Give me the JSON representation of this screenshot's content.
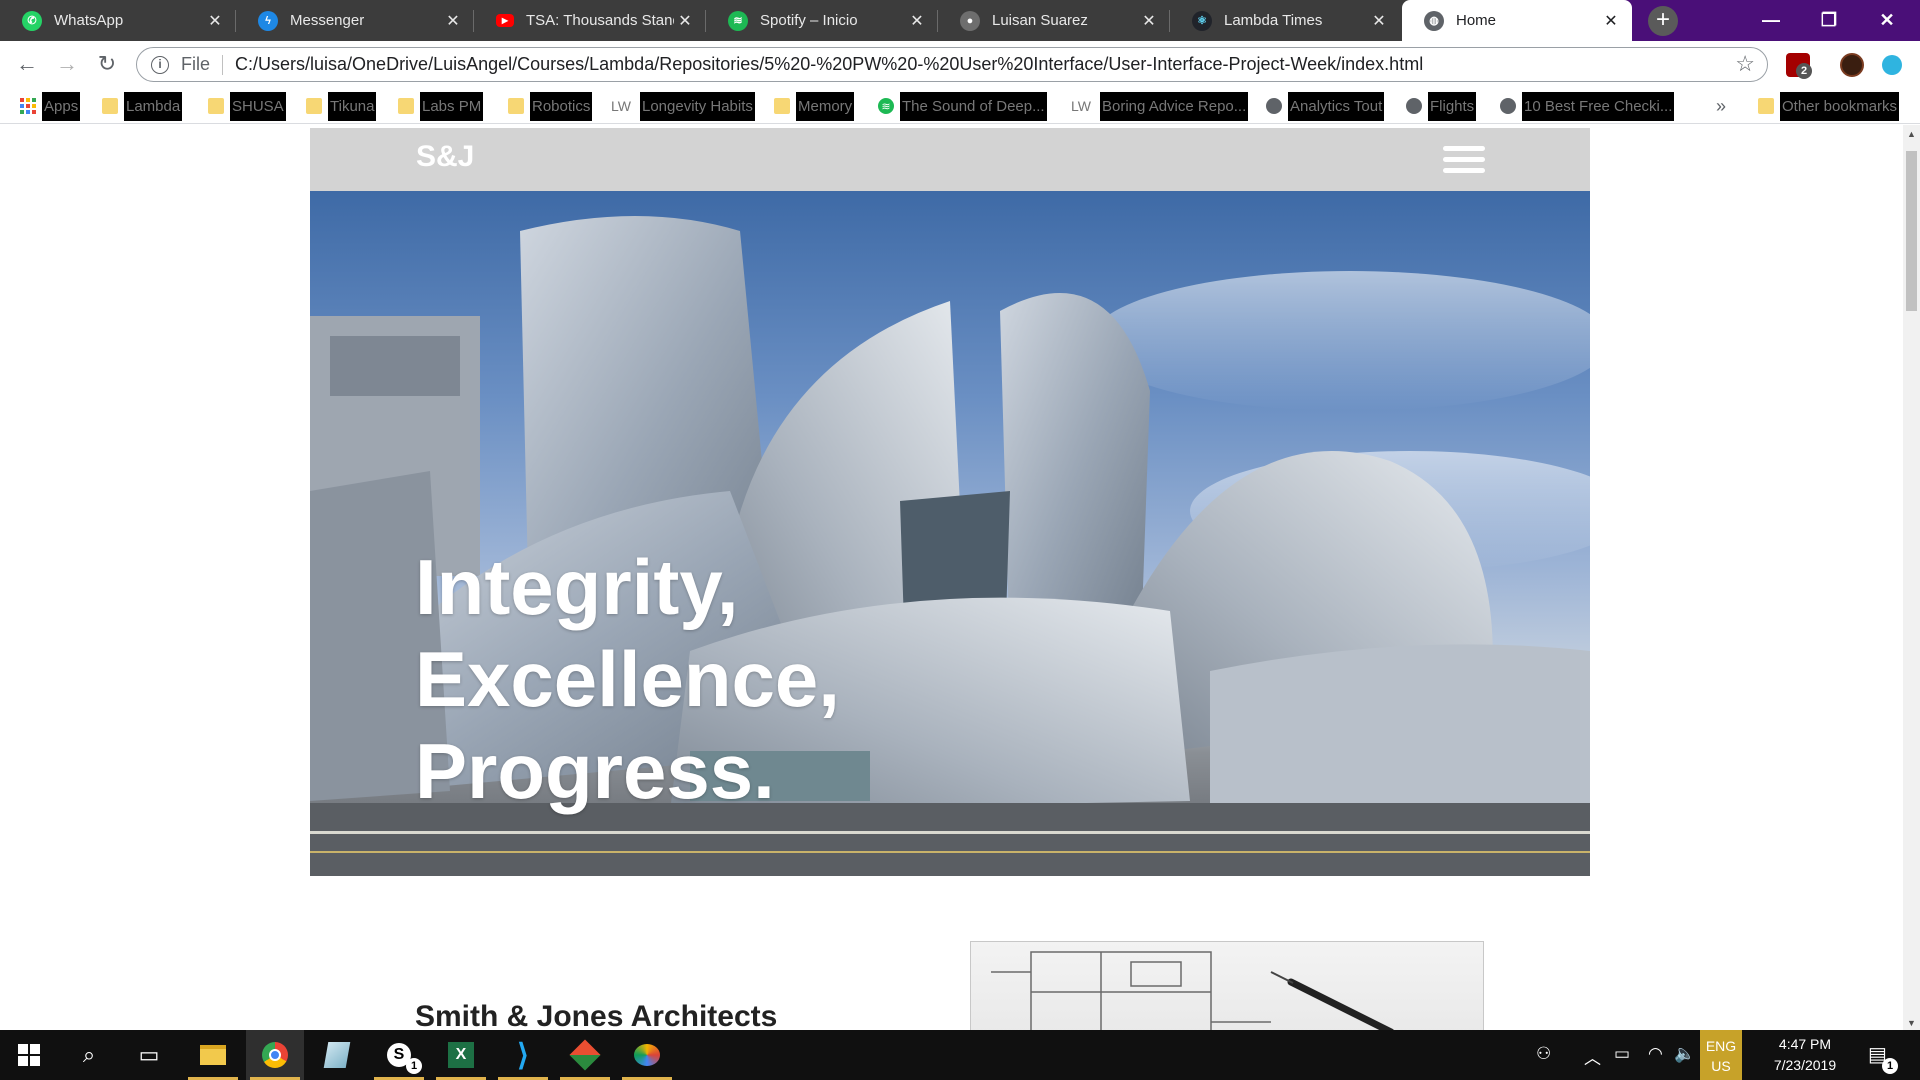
{
  "browser": {
    "tabs": [
      {
        "title": "WhatsApp",
        "icon": "whatsapp-icon",
        "color": "#25d366",
        "active": false
      },
      {
        "title": "Messenger",
        "icon": "messenger-icon",
        "color": "#1e88e5",
        "active": false
      },
      {
        "title": "TSA: Thousands Standi",
        "icon": "youtube-icon",
        "color": "#ff0000",
        "active": false
      },
      {
        "title": "Spotify – Inicio",
        "icon": "spotify-icon",
        "color": "#1db954",
        "active": false
      },
      {
        "title": "Luisan Suarez",
        "icon": "github-icon",
        "color": "#6e6e6e",
        "active": false
      },
      {
        "title": "Lambda Times",
        "icon": "react-icon",
        "color": "#61dafb",
        "active": false
      },
      {
        "title": "Home",
        "icon": "globe-icon",
        "color": "#5f6368",
        "active": true
      }
    ],
    "new_tab": "+",
    "window_controls": {
      "minimize": "—",
      "restore": "❐",
      "close": "✕"
    },
    "address": {
      "scheme": "File",
      "url": "C:/Users/luisa/OneDrive/LuisAngel/Courses/Lambda/Repositories/5%20-%20PW%20-%20User%20Interface/User-Interface-Project-Week/index.html"
    },
    "extension_badge": "2",
    "bookmarks": [
      {
        "label": "Apps",
        "type": "apps"
      },
      {
        "label": "Lambda",
        "type": "folder"
      },
      {
        "label": "SHUSA",
        "type": "folder"
      },
      {
        "label": "Tikuna",
        "type": "folder"
      },
      {
        "label": "Labs PM",
        "type": "folder"
      },
      {
        "label": "Robotics",
        "type": "folder"
      },
      {
        "label": "Longevity Habits",
        "type": "lw",
        "icon_text": "LW"
      },
      {
        "label": "Memory",
        "type": "folder"
      },
      {
        "label": "The Sound of Deep...",
        "type": "spotify"
      },
      {
        "label": "Boring Advice Repo...",
        "type": "lw",
        "icon_text": "LW"
      },
      {
        "label": "Analytics Tout",
        "type": "globe"
      },
      {
        "label": "Flights",
        "type": "globe"
      },
      {
        "label": "10 Best Free Checki...",
        "type": "globe"
      }
    ],
    "bookmarks_overflow": "»",
    "other_bookmarks": "Other bookmarks"
  },
  "site": {
    "logo": "S&J",
    "hero_lines": [
      "Integrity,",
      "Excellence,",
      "Progress."
    ],
    "company_name": "Smith & Jones Architects"
  },
  "taskbar": {
    "skype_badge": "1",
    "lang_line1": "ENG",
    "lang_line2": "US",
    "time": "4:47 PM",
    "date": "7/23/2019",
    "notification_badge": "1",
    "accent": "#e0b34c"
  }
}
